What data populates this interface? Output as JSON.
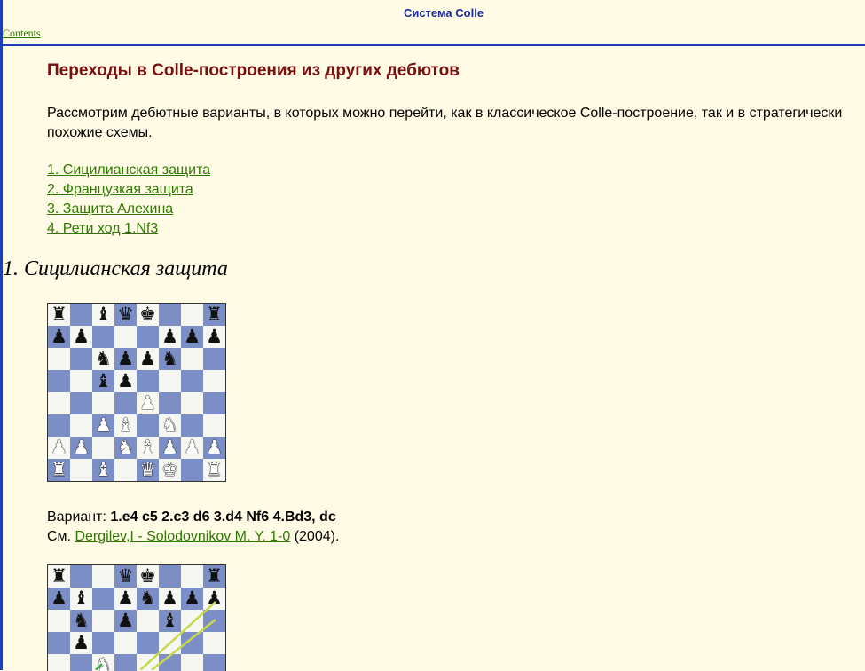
{
  "header": {
    "title": "Система Colle",
    "contents_link": "Contents"
  },
  "page_title": "Переходы в Colle-построения из других дебютов",
  "intro": "Рассмотрим дебютные варианты, в которых можно перейти, как в классическое Colle-построение, так и в стратегически похожие схемы.",
  "toc": [
    "1. Сицилианская защита",
    "2. Французкая защита",
    "3. Защита Алехина",
    "4. Рети ход 1.Nf3"
  ],
  "section1": {
    "heading": "1. Сицилианская защита",
    "board1": [
      "r.bqk..r",
      "pp...ppp",
      "..nppn..",
      "..bp....",
      "....P...",
      "..PB.N..",
      "PP.NBPPP",
      "R.B.QK.R"
    ],
    "variant_label": "Вариант:",
    "variant_moves": "1.e4 c5 2.c3 d6 3.d4 Nf6 4.Bd3, dc",
    "see_label": "См.",
    "game_link": "Dergilev,I - Solodovnikov M. Y.  1-0",
    "game_year": "(2004).",
    "board2_partial": [
      "r..qk..r",
      "pb.pnppp",
      ".n.p.b..",
      ".p......",
      "..N....."
    ]
  },
  "colors": {
    "accent_blue": "#1f3fb7",
    "title_red": "#7a0f0f",
    "link_green": "#2d7a00",
    "background": "#fffbe5"
  }
}
